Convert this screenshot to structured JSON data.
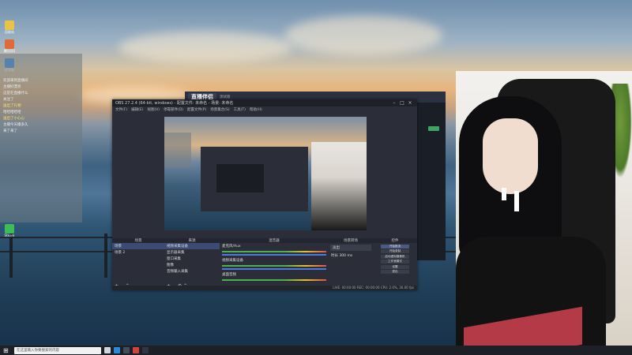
{
  "desktop": {
    "icons": [
      {
        "label": "回收站",
        "color": "#e8c34a"
      },
      {
        "label": "腾讯QQ",
        "color": "#e26a3a"
      },
      {
        "label": "此电脑",
        "color": "#3a8fe2"
      },
      {
        "label": "Steam",
        "color": "#3dbd55"
      }
    ]
  },
  "chat": {
    "lines": [
      {
        "text": "欢迎来到直播间",
        "highlight": false
      },
      {
        "text": "主播好漂亮",
        "highlight": false
      },
      {
        "text": "这是在直播什么",
        "highlight": false
      },
      {
        "text": "关注了",
        "highlight": false
      },
      {
        "text": "送出了礼物",
        "highlight": true
      },
      {
        "text": "哈哈哈哈哈",
        "highlight": false
      },
      {
        "text": "送出了小心心",
        "highlight": true
      },
      {
        "text": "主播今天播多久",
        "highlight": false
      },
      {
        "text": "来了来了",
        "highlight": false
      }
    ]
  },
  "bg_app": {
    "title": "直播伴侣",
    "tag": "测试版"
  },
  "obs": {
    "title": "OBS 27.2.4 (64-bit, windows) - 配置文件: 未命名 - 场景: 未命名",
    "menu": [
      "文件(F)",
      "编辑(E)",
      "视图(V)",
      "停靠部件(D)",
      "配置文件(P)",
      "场景集合(S)",
      "工具(T)",
      "帮助(H)"
    ],
    "scenes": {
      "header": "场景",
      "items": [
        {
          "label": "场景",
          "selected": true
        },
        {
          "label": "场景 2",
          "selected": false
        }
      ]
    },
    "sources": {
      "header": "来源",
      "items": [
        {
          "label": "视频采集设备",
          "selected": true
        },
        {
          "label": "显示器采集",
          "selected": false
        },
        {
          "label": "窗口采集",
          "selected": false
        },
        {
          "label": "图像",
          "selected": false
        },
        {
          "label": "音频输入采集",
          "selected": false
        }
      ]
    },
    "mixer": {
      "header": "混音器",
      "channels": [
        {
          "name": "麦克风/Aux",
          "db": "0.0 dB"
        },
        {
          "name": "视频采集设备",
          "db": "0.0 dB"
        },
        {
          "name": "桌面音频",
          "db": "0.0 dB"
        }
      ]
    },
    "transitions": {
      "header": "场景转场",
      "type": "淡出",
      "duration_label": "时长",
      "duration": "300 ms"
    },
    "controls": {
      "header": "控件",
      "buttons": [
        {
          "label": "开始推流",
          "active": true
        },
        {
          "label": "开始录制",
          "active": false
        },
        {
          "label": "启动虚拟摄像机",
          "active": false
        },
        {
          "label": "工作室模式",
          "active": false
        },
        {
          "label": "设置",
          "active": false
        },
        {
          "label": "退出",
          "active": false
        }
      ]
    },
    "statusbar": "LIVE: 00:00:00   REC: 00:00:00   CPU: 2.0%, 30.00 fps"
  },
  "taskbar": {
    "search_placeholder": "在这里输入你要搜索的内容",
    "apps": [
      {
        "name": "task-view",
        "color": "#cfd6e0"
      },
      {
        "name": "edge",
        "color": "#2a8ad9"
      },
      {
        "name": "obs",
        "color": "#444b5a"
      },
      {
        "name": "app-red",
        "color": "#d0453b"
      },
      {
        "name": "app-dark",
        "color": "#2f3542"
      }
    ]
  }
}
